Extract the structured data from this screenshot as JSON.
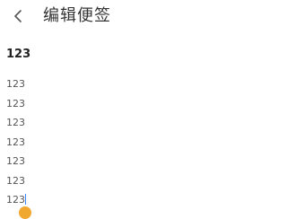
{
  "header": {
    "back_icon": "chevron-left-icon",
    "title": "编辑便签"
  },
  "note": {
    "title": "123",
    "lines": [
      "123",
      "123",
      "123",
      "123",
      "123",
      "123",
      "123"
    ]
  },
  "colors": {
    "caret": "#3a86ff",
    "selection_handle": "#f0a830"
  }
}
